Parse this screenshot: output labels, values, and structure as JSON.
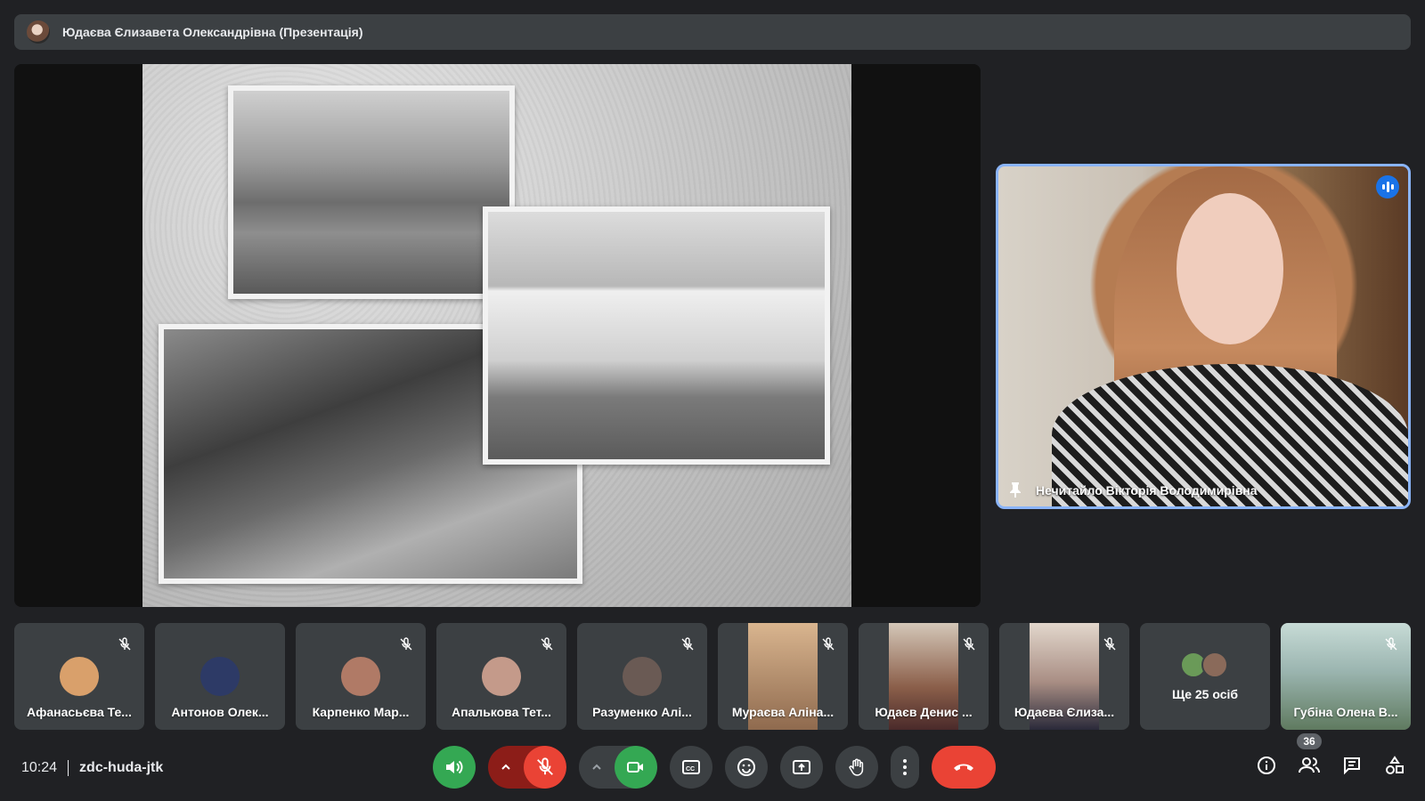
{
  "presentation": {
    "title": "Юдаєва Єлизавета Олександрівна (Презентація)"
  },
  "speaker": {
    "name": "Нечитайло Вікторія Володимирівна"
  },
  "participants": [
    {
      "name": "Афанасьєва Те...",
      "kind": "avatar",
      "avatar_color": "#d9a06b"
    },
    {
      "name": "Антонов Олек...",
      "kind": "avatar",
      "avatar_color": "#2d3a66"
    },
    {
      "name": "Карпенко Мар...",
      "kind": "avatar",
      "avatar_color": "#b07a66"
    },
    {
      "name": "Апалькова Тет...",
      "kind": "avatar",
      "avatar_color": "#c49a8a"
    },
    {
      "name": "Разуменко Алі...",
      "kind": "avatar",
      "avatar_color": "#6a5a54"
    },
    {
      "name": "Мураєва Аліна...",
      "kind": "video",
      "video_color": "#c8a27e"
    },
    {
      "name": "Юдаєв Денис ...",
      "kind": "video",
      "video_color": "#8b5f4a"
    },
    {
      "name": "Юдаєва Єлиза...",
      "kind": "video",
      "video_color": "#a98e84"
    },
    {
      "name": "Губіна Олена В...",
      "kind": "video",
      "video_color": "#9bb5b0"
    }
  ],
  "more_participants": {
    "label": "Ще 25 осіб"
  },
  "meeting": {
    "time": "10:24",
    "code": "zdc-huda-jtk",
    "participant_count": "36"
  },
  "colors": {
    "background": "#202124",
    "tile": "#3c4043",
    "accent_blue": "#8ab4f8",
    "green": "#34a853",
    "red": "#ea4335"
  }
}
